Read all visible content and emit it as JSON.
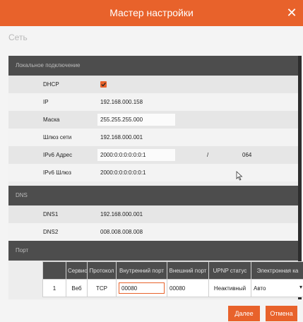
{
  "window": {
    "title": "Мастер настройки",
    "close_icon": "close-icon"
  },
  "page": {
    "subtitle": "Сеть"
  },
  "sections": {
    "local": "Локальное подключение",
    "dns": "DNS",
    "port": "Порт"
  },
  "fields": {
    "dhcp": {
      "label": "DHCP",
      "checked": true
    },
    "ip": {
      "label": "IP",
      "value": "192.168.000.158"
    },
    "mask": {
      "label": "Маска",
      "value": "255.255.255.000"
    },
    "gateway": {
      "label": "Шлюз сети",
      "value": "192.168.000.001"
    },
    "ipv6_addr": {
      "label": "IPv6 Адрес",
      "value": "2000:0:0:0:0:0:0:1",
      "separator": "/",
      "prefix": "064"
    },
    "ipv6_gw": {
      "label": "IPv6 Шлюз",
      "value": "2000:0:0:0:0:0:0:1"
    },
    "dns1": {
      "label": "DNS1",
      "value": "192.168.000.001"
    },
    "dns2": {
      "label": "DNS2",
      "value": "008.008.008.008"
    }
  },
  "port_table": {
    "headers": [
      "Сервис",
      "Протокол",
      "Внутренний порт",
      "Внешний порт",
      "UPNP статус",
      "Электронная ка"
    ],
    "rows": [
      {
        "num": "1",
        "service": "Веб",
        "protocol": "TCP",
        "internal": "00080",
        "external": "00080",
        "upnp": "Неактивный",
        "mode": "Авто"
      }
    ]
  },
  "buttons": {
    "next": "Далее",
    "cancel": "Отмена"
  },
  "colors": {
    "accent": "#e8622b",
    "section_bg": "#4d4d4d"
  }
}
